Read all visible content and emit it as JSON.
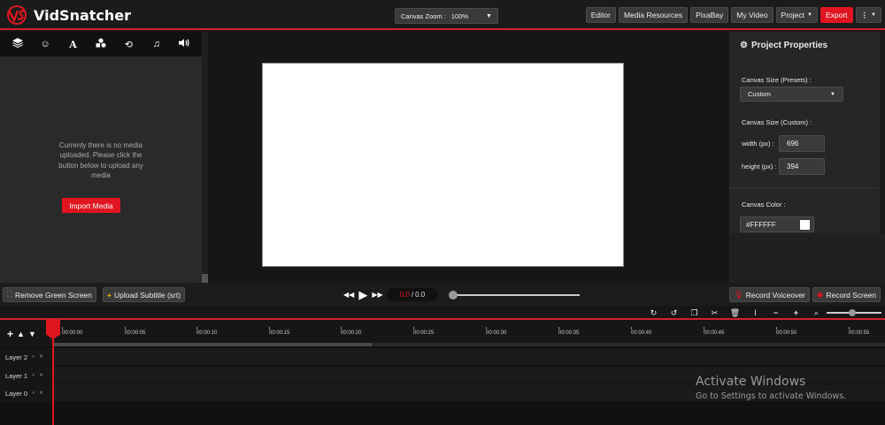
{
  "app": {
    "name": "VidSnatcher",
    "brand_color": "#e0151f"
  },
  "header": {
    "zoom_label": "Canvas Zoom :",
    "zoom_value": "100%",
    "nav": [
      "Editor",
      "Media Resources",
      "PixaBay",
      "My Video",
      "Project",
      "Export"
    ]
  },
  "left_panel": {
    "tabs": [
      "layers-icon",
      "smiley-icon",
      "text-icon",
      "shapes-icon",
      "transition-icon",
      "music-icon",
      "volume-icon"
    ],
    "empty_message": "Currenty there is no media uploaded. Please click the button below to upload any media",
    "import_label": "Import Media"
  },
  "canvas": {
    "background": "#FFFFFF"
  },
  "properties": {
    "title": "Project Properties",
    "size_presets_label": "Canvas Size (Presets) :",
    "size_preset_value": "Custom",
    "size_custom_label": "Canvas Size (Custom) :",
    "width_label": "width (px) :",
    "width_value": "696",
    "height_label": "height (px) :",
    "height_value": "394",
    "color_label": "Canvas Color :",
    "color_value": "#FFFFFF"
  },
  "controls": {
    "remove_green": "Remove Green Screen",
    "upload_subtitle": "Upload Subtitle (srt)",
    "time_current": "0.0",
    "time_sep": "/",
    "time_total": "0.0",
    "record_voiceover": "Record Voiceover",
    "record_screen": "Record Screen"
  },
  "timeline": {
    "ticks": [
      "00:00:00",
      "00:00:05",
      "00:00:10",
      "00:00:15",
      "00:00:20",
      "00:00:25",
      "00:00:30",
      "00:00:35",
      "00:00:40",
      "00:00:45",
      "00:00:50",
      "00:00:55"
    ],
    "layers": [
      "Layer 2",
      "Layer 1",
      "Layer 0"
    ]
  },
  "watermark": {
    "line1": "Activate Windows",
    "line2": "Go to Settings to activate Windows."
  }
}
